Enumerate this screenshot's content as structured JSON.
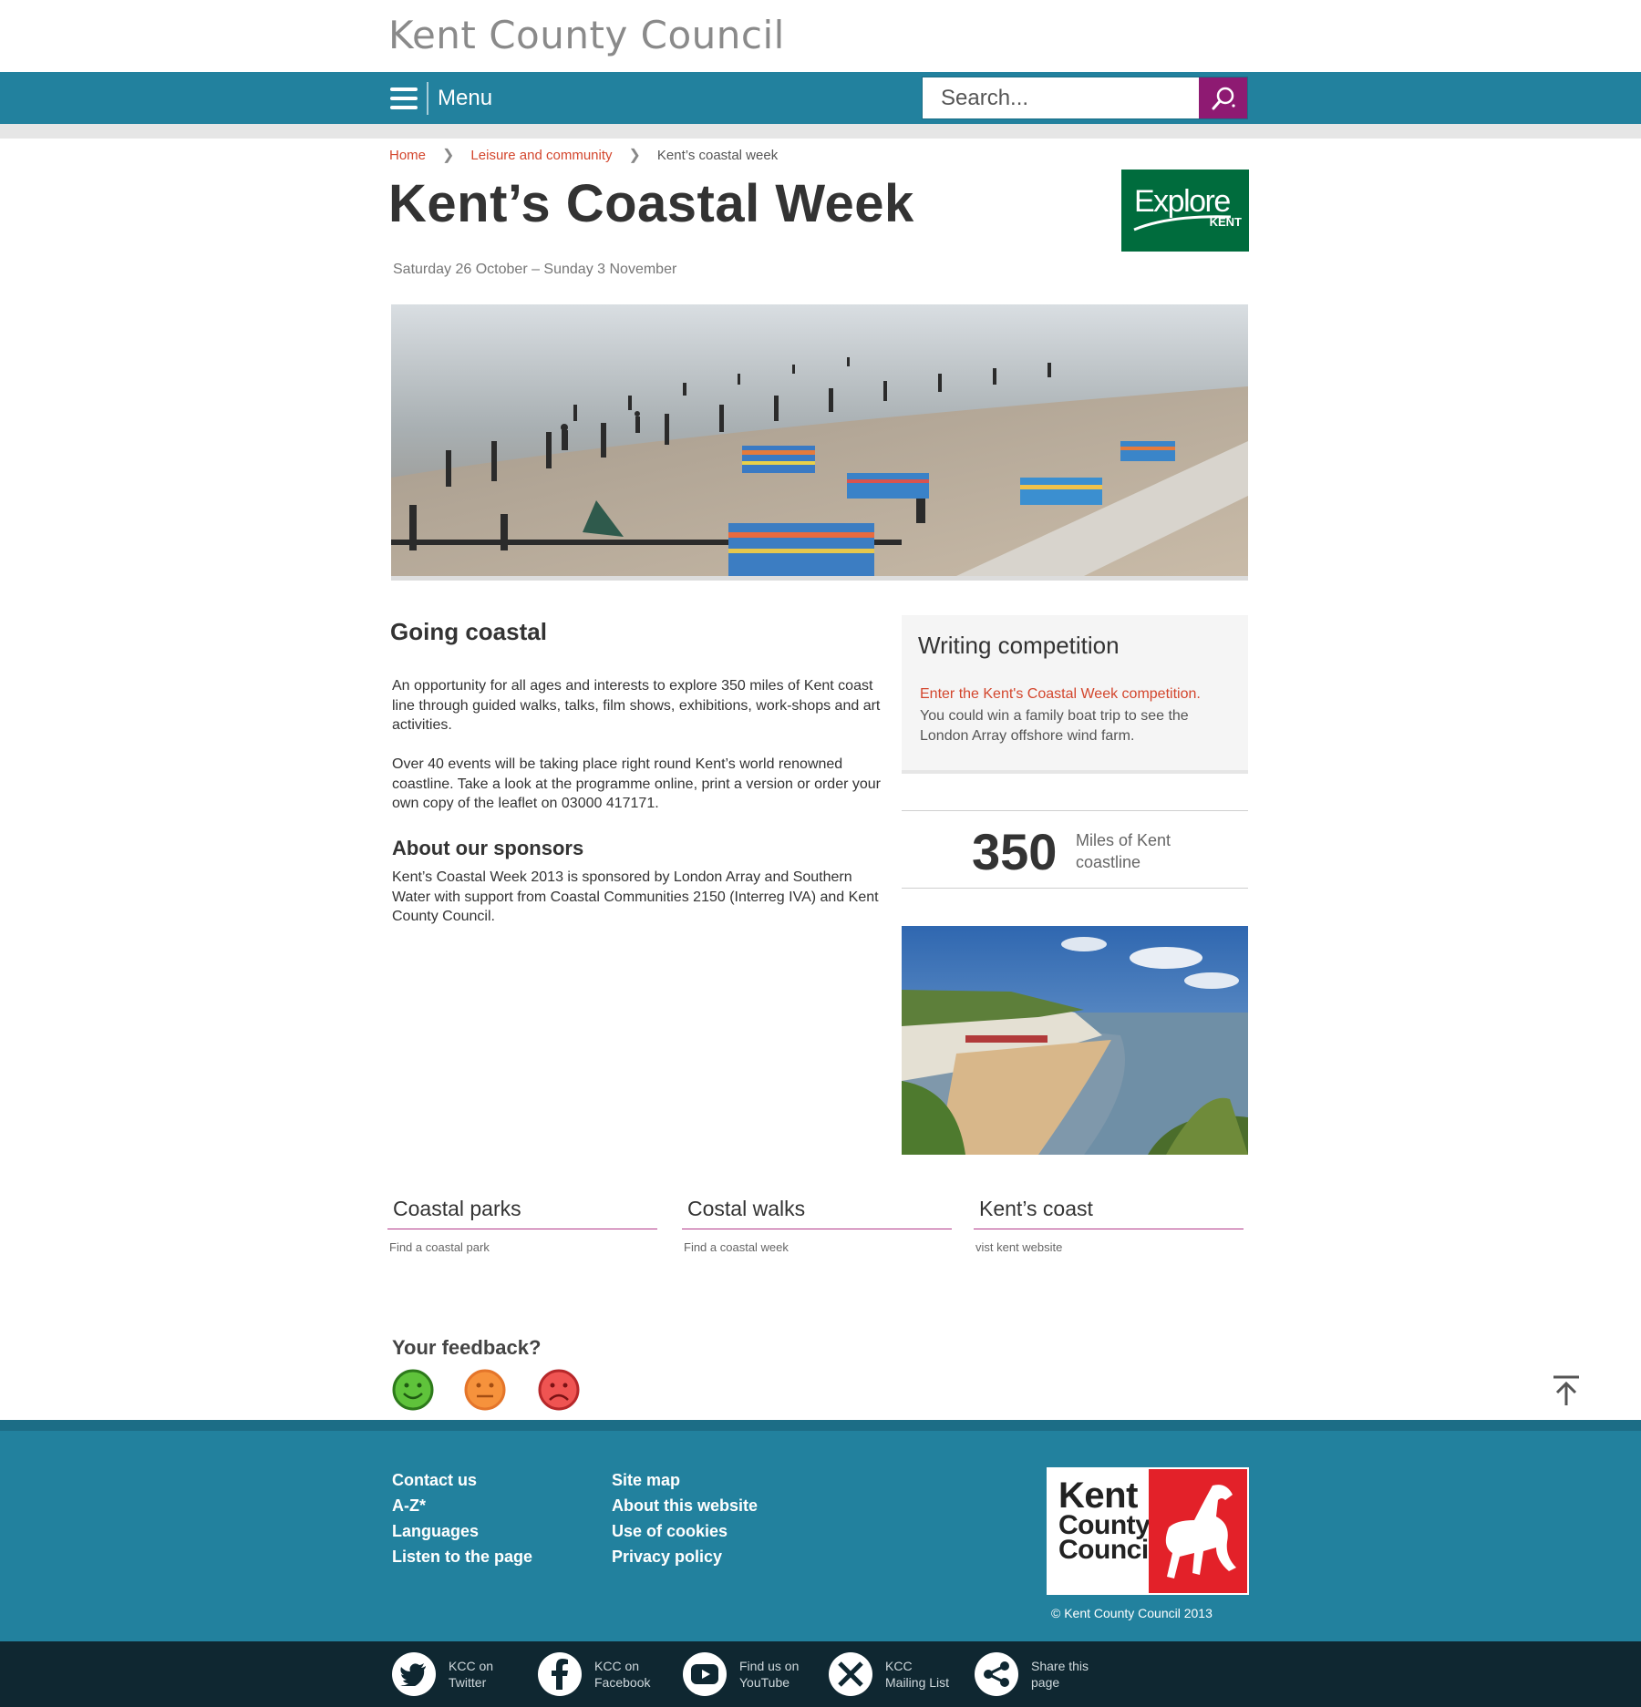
{
  "header": {
    "site_title": "Kent County Council",
    "menu_label": "Menu",
    "search_placeholder": "Search..."
  },
  "breadcrumb": {
    "home": "Home",
    "section": "Leisure and community",
    "current": "Kent’s coastal week"
  },
  "page": {
    "title": "Kent’s Coastal Week",
    "date_range": "Saturday 26 October – Sunday 3 November",
    "explore_logo": {
      "word": "Explore",
      "sub": "KENT"
    }
  },
  "main": {
    "heading": "Going coastal",
    "para1": "An opportunity for all ages and interests to explore 350 miles of Kent coast line through guided walks, talks, film shows, exhibitions, work-shops and art activities.",
    "para2": "Over 40 events will be taking place right round  Kent’s world renowned coastline. Take a look at the programme online, print a version or order your own copy of the leaflet on 03000 417171.",
    "sponsors_heading": "About our sponsors",
    "sponsors_text": "Kent’s Coastal Week 2013 is sponsored by London Array and Southern Water with support from Coastal Communities 2150 (Interreg IVA) and Kent County Council."
  },
  "sidebar": {
    "competition_title": "Writing competition",
    "competition_link": "Enter the Kent's Coastal Week competition.",
    "competition_text": "You could win a family boat trip to see the London Array offshore wind farm.",
    "stat_number": "350",
    "stat_label": "Miles of Kent coastline"
  },
  "cards": [
    {
      "title": "Coastal parks",
      "sub": "Find a coastal park"
    },
    {
      "title": "Costal walks",
      "sub": "Find a coastal week"
    },
    {
      "title": "Kent’s coast",
      "sub": "vist kent website"
    }
  ],
  "feedback": {
    "title": "Your feedback?"
  },
  "footer": {
    "col1": [
      "Contact us",
      "A-Z*",
      "Languages",
      "Listen to the page"
    ],
    "col2": [
      "Site map",
      "About this website",
      "Use of cookies",
      "Privacy policy"
    ],
    "logo_lines": [
      "Kent",
      "County",
      "Council"
    ],
    "copyright": "© Kent County Council 2013"
  },
  "social": [
    {
      "line1": "KCC on",
      "line2": "Twitter",
      "icon": "twitter-icon"
    },
    {
      "line1": "KCC on",
      "line2": "Facebook",
      "icon": "facebook-icon"
    },
    {
      "line1": "Find us on",
      "line2": "YouTube",
      "icon": "youtube-icon"
    },
    {
      "line1": "KCC",
      "line2": "Mailing List",
      "icon": "mail-icon"
    },
    {
      "line1": "Share this",
      "line2": "page",
      "icon": "share-icon"
    }
  ],
  "colors": {
    "teal": "#22819e",
    "link_red": "#d3462d",
    "magenta": "#8e1a72",
    "explore_green": "#006c3d",
    "kcc_red": "#e32129"
  }
}
